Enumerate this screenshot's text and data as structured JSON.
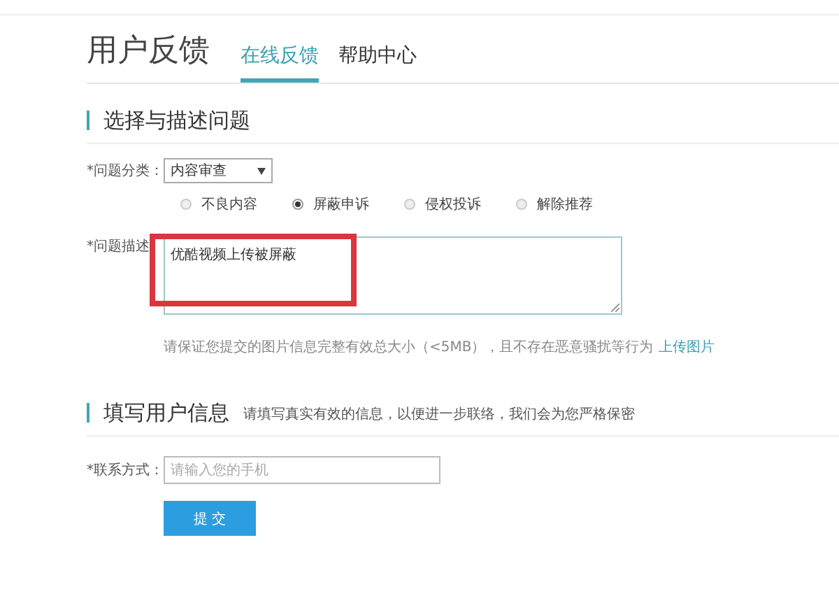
{
  "page_title": "用户反馈",
  "tabs": [
    {
      "label": "在线反馈",
      "selected": true
    },
    {
      "label": "帮助中心",
      "selected": false
    }
  ],
  "section_1": {
    "title": "选择与描述问题"
  },
  "category": {
    "label": "*问题分类：",
    "value": "内容审查"
  },
  "reasons": [
    {
      "label": "不良内容",
      "selected": false
    },
    {
      "label": "屏蔽申诉",
      "selected": true
    },
    {
      "label": "侵权投诉",
      "selected": false
    },
    {
      "label": "解除推荐",
      "selected": false
    }
  ],
  "description": {
    "label": "*问题描述",
    "value": "优酷视频上传被屏蔽"
  },
  "hint": {
    "text": "请保证您提交的图片信息完整有效总大小（<5MB），且不存在恶意骚扰等行为",
    "link": "上传图片"
  },
  "section_2": {
    "title": "填写用户信息",
    "note": "请填写真实有效的信息，以便进一步联络，我们会为您严格保密"
  },
  "contact": {
    "label": "*联系方式：",
    "placeholder": "请输入您的手机"
  },
  "submit": "提 交"
}
